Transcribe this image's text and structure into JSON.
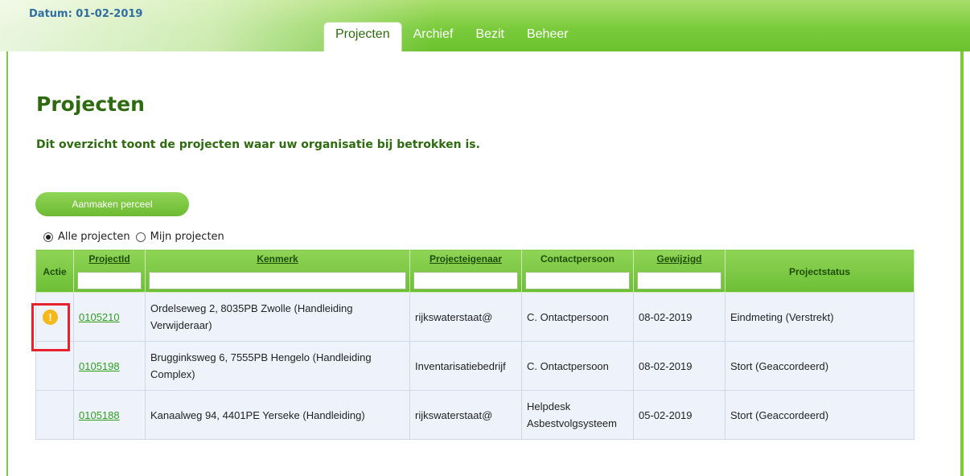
{
  "header": {
    "date": "Datum: 01-02-2019"
  },
  "tabs": [
    {
      "label": "Projecten",
      "active": true
    },
    {
      "label": "Archief",
      "active": false
    },
    {
      "label": "Bezit",
      "active": false
    },
    {
      "label": "Beheer",
      "active": false
    }
  ],
  "page": {
    "title": "Projecten",
    "subtitle": "Dit overzicht toont de projecten waar uw organisatie bij betrokken is.",
    "create_button": "Aanmaken perceel"
  },
  "filter": {
    "all_label": "Alle projecten",
    "mine_label": "Mijn projecten",
    "selected": "all"
  },
  "table": {
    "headers": {
      "actie": "Actie",
      "projectid": "ProjectId",
      "kenmerk": "Kenmerk",
      "eigenaar": "Projecteigenaar",
      "contact": "Contactpersoon",
      "gewijzigd": "Gewijzigd",
      "status": "Projectstatus"
    },
    "rows": [
      {
        "warning": true,
        "id": "0105210",
        "kenmerk": "Ordelseweg 2, 8035PB Zwolle (Handleiding Verwijderaar)",
        "eigenaar": "rijkswaterstaat@",
        "contact": "C. Ontactpersoon",
        "gewijzigd": "08-02-2019",
        "status": "Eindmeting (Verstrekt)"
      },
      {
        "warning": false,
        "id": "0105198",
        "kenmerk": "Brugginksweg 6, 7555PB Hengelo (Handleiding Complex)",
        "eigenaar": "Inventarisatiebedrijf",
        "contact": "C. Ontactpersoon",
        "gewijzigd": "08-02-2019",
        "status": "Stort (Geaccordeerd)"
      },
      {
        "warning": false,
        "id": "0105188",
        "kenmerk": "Kanaalweg 94, 4401PE Yerseke (Handleiding)",
        "eigenaar": "rijkswaterstaat@",
        "contact": "Helpdesk Asbestvolgsysteem",
        "gewijzigd": "05-02-2019",
        "status": "Stort (Geaccordeerd)"
      }
    ]
  },
  "colors": {
    "brand_green": "#7acb3c",
    "title_green": "#2e6b10",
    "link_green": "#2f9e1f",
    "warning": "#f5b81b",
    "highlight": "#e8222c"
  },
  "icons": {
    "warning": "exclamation-circle-icon"
  }
}
